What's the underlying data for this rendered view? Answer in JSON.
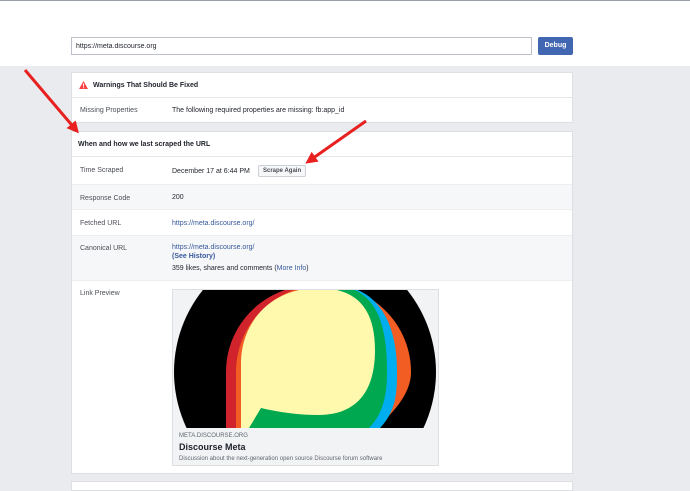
{
  "search": {
    "url_value": "https://meta.discourse.org",
    "debug_label": "Debug"
  },
  "warnings": {
    "title": "Warnings That Should Be Fixed",
    "rows": [
      {
        "label": "Missing Properties",
        "value": "The following required properties are missing: fb:app_id"
      }
    ]
  },
  "scrape": {
    "title": "When and how we last scraped the URL",
    "time_label": "Time Scraped",
    "time_value": "December 17 at 6:44 PM",
    "scrape_again_label": "Scrape Again",
    "response_label": "Response Code",
    "response_value": "200",
    "fetched_label": "Fetched URL",
    "fetched_value": "https://meta.discourse.org/",
    "canonical_label": "Canonical URL",
    "canonical_value": "https://meta.discourse.org/",
    "see_history": "(See History)",
    "likes_text": "359 likes, shares and comments (",
    "more_info": "More Info",
    "likes_close": ")",
    "preview_label": "Link Preview"
  },
  "preview": {
    "domain": "META.DISCOURSE.ORG",
    "title": "Discourse Meta",
    "description": "Discussion about the next-generation open source Discourse forum software"
  },
  "colors": {
    "accent": "#4267b2",
    "link": "#365899",
    "warning": "#fa3e3e",
    "annotation_arrow": "#e8201f",
    "logo_yellow": "#fff9ae",
    "logo_blue": "#00aeef",
    "logo_green": "#00a94f",
    "logo_orange": "#f15d22",
    "logo_red": "#d0232b"
  },
  "icons": {
    "warning": "warning-triangle-icon",
    "annotation": "red-arrow-icon"
  }
}
